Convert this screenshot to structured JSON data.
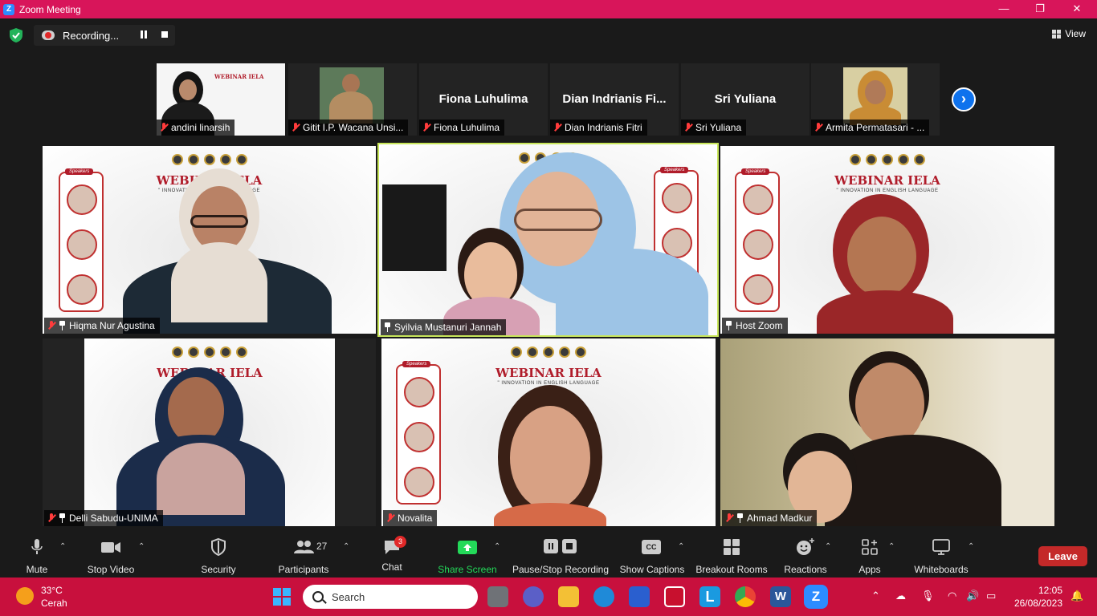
{
  "window": {
    "title": "Zoom Meeting",
    "minimize": "—",
    "maximize": "❐",
    "close": "✕"
  },
  "recording": {
    "label": "Recording..."
  },
  "view": {
    "label": "View"
  },
  "thumbnails": [
    {
      "name": "andini linarsih",
      "muted": true
    },
    {
      "name": "Gitit I.P. Wacana Unsi...",
      "muted": true
    },
    {
      "name": "Fiona Luhulima",
      "display_name": "Fiona Luhulima",
      "muted": true
    },
    {
      "name": "Dian Indrianis Fitri",
      "display_name": "Dian  Indrianis  Fi...",
      "muted": true
    },
    {
      "name": "Sri Yuliana",
      "display_name": "Sri Yuliana",
      "muted": true
    },
    {
      "name": "Armita Permatasari - ...",
      "muted": true
    }
  ],
  "tiles": [
    {
      "name": "Hiqma Nur Agustina",
      "muted": true,
      "pinned": true
    },
    {
      "name": "Syilvia Mustanuri Jannah",
      "muted": false,
      "pinned": true,
      "active_speaker": true
    },
    {
      "name": "Host Zoom",
      "muted": false,
      "pinned": true
    },
    {
      "name": "Delli Sabudu-UNIMA",
      "muted": true,
      "pinned": true
    },
    {
      "name": "Novalita",
      "muted": true,
      "pinned": false
    },
    {
      "name": "Ahmad Madkur",
      "muted": true,
      "pinned": true
    }
  ],
  "banner": {
    "title": "WEBINAR IELA",
    "subtitle": "\" INNOVATION IN ENGLISH LANGUAGE",
    "speakers_tag": "Speakers"
  },
  "toolbar": {
    "mute": "Mute",
    "stop_video": "Stop Video",
    "security": "Security",
    "participants": "Participants",
    "participants_count": "27",
    "chat": "Chat",
    "chat_badge": "3",
    "share_screen": "Share Screen",
    "pause_stop_recording": "Pause/Stop Recording",
    "show_captions": "Show Captions",
    "cc": "CC",
    "breakout_rooms": "Breakout Rooms",
    "reactions": "Reactions",
    "apps": "Apps",
    "whiteboards": "Whiteboards",
    "leave": "Leave"
  },
  "taskbar": {
    "temperature": "33°C",
    "weather": "Cerah",
    "search_placeholder": "Search",
    "time": "12:05",
    "date": "26/08/2023"
  },
  "colors": {
    "titlebar": "#d8155a",
    "taskbar": "#c8103d",
    "accent": "#0e72ed",
    "leave": "#c42929",
    "active_border": "#c8e65a",
    "share": "#23d959"
  }
}
